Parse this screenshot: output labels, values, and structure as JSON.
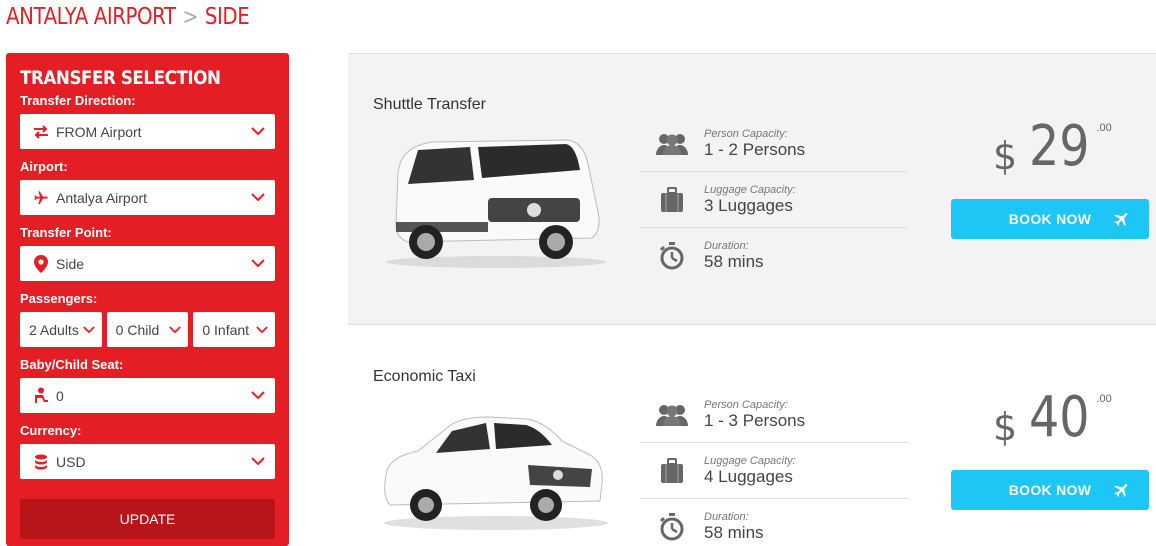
{
  "breadcrumb": {
    "from": "ANTALYA AIRPORT",
    "separator": ">",
    "to": "SIDE"
  },
  "sidebar": {
    "title": "TRANSFER SELECTION",
    "direction_label": "Transfer Direction:",
    "direction_value": "FROM Airport",
    "airport_label": "Airport:",
    "airport_value": "Antalya Airport",
    "point_label": "Transfer Point:",
    "point_value": "Side",
    "passengers_label": "Passengers:",
    "adults_value": "2 Adults",
    "child_value": "0 Child",
    "infant_value": "0 Infant",
    "seat_label": "Baby/Child Seat:",
    "seat_value": "0",
    "currency_label": "Currency:",
    "currency_value": "USD",
    "update_label": "UPDATE"
  },
  "results": [
    {
      "title": "Shuttle Transfer",
      "person_label": "Person Capacity:",
      "person_value": "1 - 2 Persons",
      "luggage_label": "Luggage Capacity:",
      "luggage_value": "3 Luggages",
      "duration_label": "Duration:",
      "duration_value": "58 mins",
      "currency_symbol": "$",
      "price": "29",
      "cents": ".00",
      "book_label": "BOOK NOW"
    },
    {
      "title": "Economic Taxi",
      "person_label": "Person Capacity:",
      "person_value": "1 - 3 Persons",
      "luggage_label": "Luggage Capacity:",
      "luggage_value": "4 Luggages",
      "duration_label": "Duration:",
      "duration_value": "58 mins",
      "currency_symbol": "$",
      "price": "40",
      "cents": ".00",
      "book_label": "BOOK NOW"
    }
  ],
  "colors": {
    "brand_red": "#e31e24",
    "update_red": "#b71519",
    "book_blue": "#1ec6f5"
  }
}
